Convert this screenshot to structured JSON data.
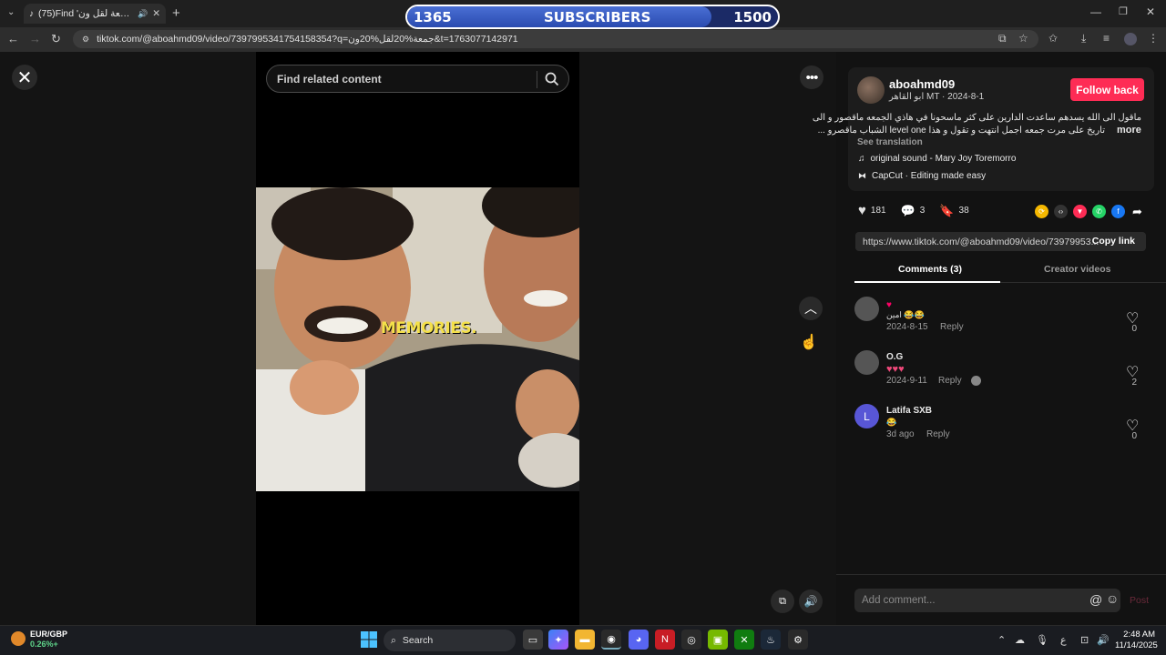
{
  "browser": {
    "tab_title": "(75)Find 'جمعة لقل ون' on T",
    "url": "tiktok.com/@aboahmd09/video/7397995341754158354?q=جمعة%20لقل%20ون&t=1763077142971"
  },
  "overlay": {
    "start": "1365",
    "label": "SUBSCRIBERS",
    "goal": "1500",
    "progress": 0.82
  },
  "player": {
    "search_placeholder": "Find related content",
    "caption_overlay": "MEMORIES."
  },
  "author": {
    "username": "aboahmd09",
    "subline": "ابو القاهر MT · 2024-8-1",
    "follow_label": "Follow back",
    "caption_line1": "ماقول الى الله يسدهم ساعدت الدارين على كثر ماسحونا في هاذي الجمعه ماقصور و الى",
    "caption_line2": "تاريخ على مرت جمعه اجمل انتهت و تقول و هذا level one الشباب ماقصرو ...",
    "more": "more",
    "see_translation": "See translation",
    "sound": "original sound - Mary Joy Toremorro",
    "capcut": "CapCut · Editing made easy"
  },
  "stats": {
    "likes": "181",
    "comments": "3",
    "saves": "38"
  },
  "share": {
    "link": "https://www.tiktok.com/@aboahmd09/video/73979953...",
    "copy_label": "Copy link"
  },
  "panel_tabs": {
    "comments": "Comments (3)",
    "creator_videos": "Creator videos"
  },
  "comments": [
    {
      "name": "",
      "text": "امين 😂😂",
      "date": "2024-8-15",
      "reply": "Reply",
      "likes": "0"
    },
    {
      "name": "O.G",
      "text": "♥♥♥",
      "date": "2024-9-11",
      "reply": "Reply",
      "likes": "2"
    },
    {
      "name": "Latifa SXB",
      "avatar_letter": "L",
      "text": "😂",
      "date": "3d ago",
      "reply": "Reply",
      "likes": "0"
    }
  ],
  "comment_input": {
    "placeholder": "Add comment...",
    "post_label": "Post"
  },
  "taskbar": {
    "fx_pair": "EUR/GBP",
    "fx_change": "0.26%+",
    "search_label": "Search",
    "time": "2:48 AM",
    "date": "11/14/2025",
    "lang": "ع"
  }
}
